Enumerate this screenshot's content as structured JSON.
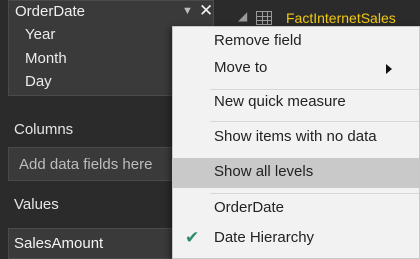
{
  "fields_pane": {
    "date_field": {
      "name": "OrderDate",
      "chevron_icon": "chevron-down-icon",
      "close_icon": "close-icon",
      "hierarchy_levels": [
        "Year",
        "Month",
        "Day"
      ]
    },
    "columns": {
      "label": "Columns",
      "placeholder": "Add data fields here"
    },
    "values": {
      "label": "Values",
      "field": "SalesAmount"
    }
  },
  "tree": {
    "table_name": "FactInternetSales",
    "table_icon": "table-icon",
    "caret_icon": "caret-down-icon"
  },
  "context_menu": {
    "items": [
      {
        "label": "Remove field"
      },
      {
        "label": "Move to",
        "has_submenu": true
      },
      {
        "label": "New quick measure"
      },
      {
        "label": "Show items with no data"
      },
      {
        "label": "Show all levels",
        "highlighted": true
      },
      {
        "label": "OrderDate"
      },
      {
        "label": "Date Hierarchy",
        "checked": true
      }
    ]
  },
  "colors": {
    "background": "#2b2b2b",
    "menu_bg": "#f2f2f2",
    "menu_highlight": "#c9c9c9",
    "check": "#2e8b6a",
    "table_name": "#f2c811"
  }
}
